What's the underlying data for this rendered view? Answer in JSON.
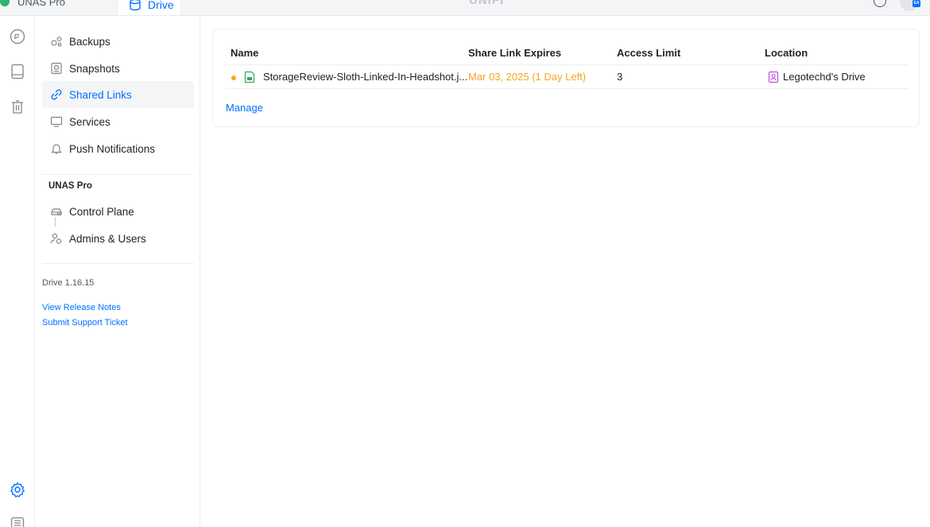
{
  "topbar": {
    "app_name": "UNAS Pro",
    "active_tab": "Drive",
    "center_title": "UNIFI"
  },
  "rail": {
    "icons": [
      "sync-icon",
      "device-icon",
      "trash-icon",
      "settings-icon",
      "list-icon"
    ]
  },
  "sidebar": {
    "items": [
      {
        "label": "Backups",
        "icon": "backups-icon"
      },
      {
        "label": "Snapshots",
        "icon": "snapshots-icon"
      },
      {
        "label": "Shared Links",
        "icon": "link-icon",
        "active": true
      },
      {
        "label": "Services",
        "icon": "monitor-icon"
      },
      {
        "label": "Push Notifications",
        "icon": "bell-icon"
      }
    ],
    "section_title": "UNAS Pro",
    "section_items": [
      {
        "label": "Control Plane",
        "icon": "control-plane-icon"
      },
      {
        "label": "Admins & Users",
        "icon": "users-icon"
      }
    ],
    "version": "Drive 1.16.15",
    "release_notes": "View Release Notes",
    "support": "Submit Support Ticket"
  },
  "table": {
    "headers": [
      "Name",
      "Share Link Expires",
      "Access Limit",
      "Location"
    ],
    "rows": [
      {
        "name": "StorageReview-Sloth-Linked-In-Headshot.j...",
        "expires": "Mar 03, 2025 (1 Day Left)",
        "access_limit": "3",
        "location": "Legotechd's Drive"
      }
    ],
    "manage_label": "Manage"
  },
  "colors": {
    "accent": "#006fff",
    "warning": "#f5a623",
    "location_icon": "#b84fd6",
    "file_icon": "#3aa65a"
  }
}
